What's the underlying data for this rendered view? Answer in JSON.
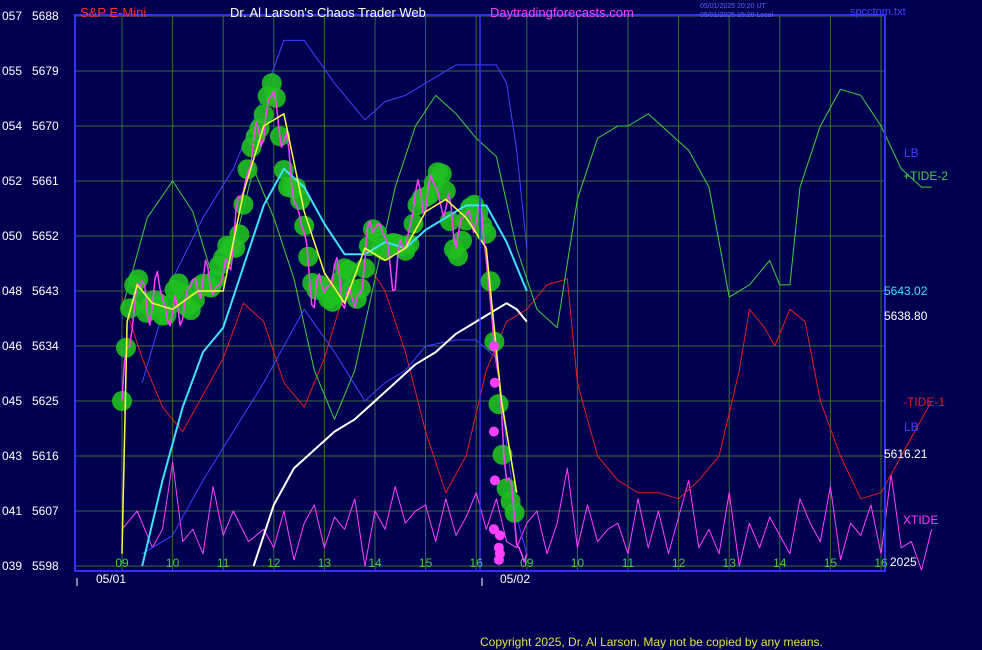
{
  "header": {
    "instrument": "S&P E-Mini",
    "title": "Dr. Al Larson's Chaos Trader Web",
    "site": "Daytradingforecasts.com",
    "stamp_line1": "05/01/2025 20:20 UT",
    "stamp_line2": "05/01/2025 15:20 Local",
    "file": "spcctom.txt"
  },
  "footer": {
    "copyright": "Copyright 2025, Dr. Al Larson. May not be copied by any means."
  },
  "colors": {
    "background": "#000050",
    "plot_border": "#3030ff",
    "grid": "#3c6a3c",
    "price": "#ff40ff",
    "fast_avg": "#ffff40",
    "mid_avg": "#40e0ff",
    "slow_avg": "#ffffff",
    "band": "#4040ff",
    "tide_plus": "#40d040",
    "tide_minus": "#e02020",
    "xtide": "#ff40ff",
    "green_dots": "#20c020"
  },
  "chart_data": {
    "type": "line",
    "title": "S&P E-Mini",
    "ylim": [
      5598,
      5688
    ],
    "y_ticks_left": [
      {
        "left": "057",
        "right": "5688",
        "value": 5688
      },
      {
        "left": "055",
        "right": "5679",
        "value": 5679
      },
      {
        "left": "054",
        "right": "5670",
        "value": 5670
      },
      {
        "left": "052",
        "right": "5661",
        "value": 5661
      },
      {
        "left": "050",
        "right": "5652",
        "value": 5652
      },
      {
        "left": "048",
        "right": "5643",
        "value": 5643
      },
      {
        "left": "046",
        "right": "5634",
        "value": 5634
      },
      {
        "left": "045",
        "right": "5625",
        "value": 5625
      },
      {
        "left": "043",
        "right": "5616",
        "value": 5616
      },
      {
        "left": "041",
        "right": "5607",
        "value": 5607
      },
      {
        "left": "039",
        "right": "5598",
        "value": 5598
      }
    ],
    "x_hour_labels": [
      "09",
      "10",
      "11",
      "12",
      "13",
      "14",
      "15",
      "16",
      "09",
      "10",
      "11",
      "12",
      "13",
      "14",
      "15",
      "16"
    ],
    "date_labels": [
      "05/01",
      "05/02"
    ],
    "right_labels": {
      "lb_top": "LB",
      "tide_plus": "+TIDE-2",
      "mid_value": "5643.02",
      "white_value": "5638.80",
      "tide_minus": "-TIDE-1",
      "lb_bottom": "LB",
      "lb_value": "5616.21",
      "xtide": "XTIDE",
      "year": "2025"
    },
    "series": [
      {
        "name": "price",
        "x": [
          0,
          0.3,
          0.5,
          0.7,
          1.0,
          1.5,
          2.0,
          2.5,
          3.0,
          3.4,
          3.8,
          4.2,
          4.6,
          5.0,
          5.4,
          5.8,
          6.2,
          6.6,
          7.0,
          7.2,
          7.4,
          7.6,
          7.8,
          8.0
        ],
        "values": [
          5625,
          5645,
          5640,
          5644,
          5638,
          5645,
          5644,
          5664,
          5675,
          5660,
          5642,
          5646,
          5640,
          5656,
          5645,
          5658,
          5660,
          5653,
          5656,
          5650,
          5630,
          5615,
          5602,
          5600
        ]
      },
      {
        "name": "fast",
        "x": [
          0,
          0.1,
          0.3,
          0.6,
          1.0,
          1.5,
          2.0,
          2.4,
          2.8,
          3.2,
          3.6,
          4.0,
          4.4,
          4.8,
          5.2,
          5.6,
          6.0,
          6.4,
          6.8,
          7.2,
          7.5,
          7.8
        ],
        "values": [
          5600,
          5638,
          5644,
          5641,
          5640,
          5643,
          5643,
          5659,
          5670,
          5672,
          5656,
          5646,
          5641,
          5650,
          5648,
          5650,
          5656,
          5658,
          5655,
          5650,
          5625,
          5610
        ]
      },
      {
        "name": "mid",
        "x": [
          0.4,
          0.8,
          1.2,
          1.6,
          2.0,
          2.4,
          2.8,
          3.2,
          3.6,
          4.0,
          4.4,
          4.8,
          5.2,
          5.6,
          6.0,
          6.4,
          6.8,
          7.2,
          7.6,
          8.0
        ],
        "values": [
          5598,
          5612,
          5624,
          5633,
          5637,
          5647,
          5657,
          5663,
          5660,
          5654,
          5649,
          5649,
          5651,
          5650,
          5653,
          5655,
          5657,
          5657,
          5651,
          5643
        ]
      },
      {
        "name": "slow",
        "x": [
          2.6,
          3.0,
          3.4,
          3.8,
          4.2,
          4.6,
          5.0,
          5.4,
          5.8,
          6.2,
          6.6,
          7.0,
          7.4,
          7.6,
          7.8,
          8.0
        ],
        "values": [
          5598,
          5608,
          5614,
          5617,
          5620,
          5622,
          5625,
          5628,
          5631,
          5633,
          5636,
          5638,
          5640,
          5641,
          5640,
          5638
        ]
      },
      {
        "name": "band_upper",
        "x": [
          0.4,
          1.0,
          1.6,
          2.2,
          2.8,
          3.2,
          3.6,
          4.2,
          4.8,
          5.2,
          5.6,
          6.0,
          6.6,
          7.0,
          7.4,
          7.6,
          7.8,
          8.0
        ],
        "values": [
          5628,
          5645,
          5655,
          5663,
          5675,
          5684,
          5684,
          5677,
          5671,
          5674,
          5675,
          5677,
          5680,
          5680,
          5680,
          5677,
          5666,
          5650
        ]
      },
      {
        "name": "band_lower",
        "x": [
          0.4,
          1.0,
          1.6,
          2.2,
          2.8,
          3.2,
          3.6,
          4.2,
          4.8,
          5.2,
          5.6,
          6.0,
          6.6,
          7.0,
          7.4,
          7.6,
          7.8,
          8.0
        ],
        "values": [
          5600,
          5603,
          5612,
          5620,
          5628,
          5634,
          5640,
          5633,
          5625,
          5628,
          5630,
          5634,
          5635,
          5635,
          5632,
          5618,
          5606,
          5600
        ]
      }
    ],
    "tide_plus": {
      "x": [
        0,
        0.5,
        1.0,
        1.4,
        1.8,
        2.2,
        2.6,
        3.0,
        3.4,
        3.8,
        4.2,
        4.6,
        5.0,
        5.4,
        5.8,
        6.2,
        6.6,
        7.0,
        7.4,
        7.8,
        8.2,
        8.6,
        9.0,
        9.4,
        9.8,
        10.0,
        10.4,
        10.8,
        11.2,
        11.6,
        12.0,
        12.4,
        12.8,
        13.0,
        13.2,
        13.4,
        13.8,
        14.2,
        14.6,
        15.0,
        15.4,
        15.8,
        16.0
      ],
      "values": [
        5640,
        5655,
        5661,
        5656,
        5645,
        5650,
        5663,
        5655,
        5645,
        5630,
        5622,
        5630,
        5645,
        5660,
        5670,
        5675,
        5672,
        5668,
        5665,
        5650,
        5640,
        5637,
        5658,
        5668,
        5670,
        5670,
        5672,
        5669,
        5666,
        5660,
        5642,
        5644,
        5648,
        5644,
        5644,
        5660,
        5670,
        5676,
        5675,
        5670,
        5663,
        5660,
        5660
      ]
    },
    "tide_minus": {
      "x": [
        0,
        0.4,
        0.8,
        1.2,
        1.6,
        2.0,
        2.4,
        2.8,
        3.2,
        3.6,
        4.0,
        4.4,
        4.8,
        5.2,
        5.6,
        6.0,
        6.4,
        6.8,
        7.2,
        7.6,
        8.0,
        8.4,
        8.8,
        9.0,
        9.4,
        9.8,
        10.2,
        10.6,
        11.0,
        11.4,
        11.8,
        12.2,
        12.4,
        12.7,
        12.9,
        13.2,
        13.5,
        13.8,
        14.2,
        14.6,
        15.0,
        15.4,
        15.8,
        16.0
      ],
      "values": [
        5642,
        5632,
        5624,
        5620,
        5626,
        5632,
        5641,
        5638,
        5628,
        5624,
        5632,
        5643,
        5648,
        5643,
        5633,
        5620,
        5610,
        5616,
        5630,
        5638,
        5640,
        5644,
        5645,
        5628,
        5616,
        5612,
        5610,
        5610,
        5609,
        5612,
        5616,
        5630,
        5640,
        5637,
        5634,
        5640,
        5638,
        5625,
        5616,
        5609,
        5610,
        5616,
        5622,
        5625
      ]
    },
    "xtide": {
      "x": [
        0,
        0.3,
        0.6,
        0.8,
        1.0,
        1.2,
        1.4,
        1.6,
        1.8,
        2.0,
        2.2,
        2.5,
        2.8,
        3.0,
        3.2,
        3.4,
        3.6,
        3.8,
        4.0,
        4.2,
        4.4,
        4.6,
        4.8,
        5.0,
        5.2,
        5.4,
        5.6,
        5.8,
        6.0,
        6.2,
        6.4,
        6.6,
        6.8,
        7.0,
        7.2,
        7.4,
        7.6,
        7.8,
        8.0,
        8.2,
        8.4,
        8.6,
        8.8,
        9.0,
        9.2,
        9.4,
        9.6,
        9.8,
        10.0,
        10.2,
        10.4,
        10.6,
        10.8,
        11.0,
        11.2,
        11.4,
        11.6,
        11.8,
        12.0,
        12.2,
        12.4,
        12.6,
        12.8,
        13.0,
        13.2,
        13.4,
        13.6,
        13.8,
        14.0,
        14.2,
        14.4,
        14.6,
        14.8,
        15.0,
        15.2,
        15.4,
        15.6,
        15.8,
        16.0
      ],
      "values": [
        5604,
        5607,
        5601,
        5604,
        5615,
        5602,
        5604,
        5600,
        5611,
        5603,
        5607,
        5602,
        5604,
        5601,
        5607,
        5599,
        5605,
        5608,
        5601,
        5606,
        5604,
        5609,
        5598,
        5607,
        5604,
        5611,
        5605,
        5607,
        5608,
        5602,
        5609,
        5603,
        5606,
        5610,
        5604,
        5609,
        5602,
        5601,
        5605,
        5607,
        5600,
        5605,
        5614,
        5601,
        5608,
        5602,
        5604,
        5605,
        5600,
        5609,
        5601,
        5607,
        5600,
        5606,
        5612,
        5601,
        5604,
        5600,
        5610,
        5598,
        5605,
        5601,
        5606,
        5603,
        5600,
        5609,
        5605,
        5602,
        5611,
        5599,
        5605,
        5603,
        5608,
        5600,
        5613,
        5601,
        5602,
        5597,
        5604
      ]
    }
  }
}
